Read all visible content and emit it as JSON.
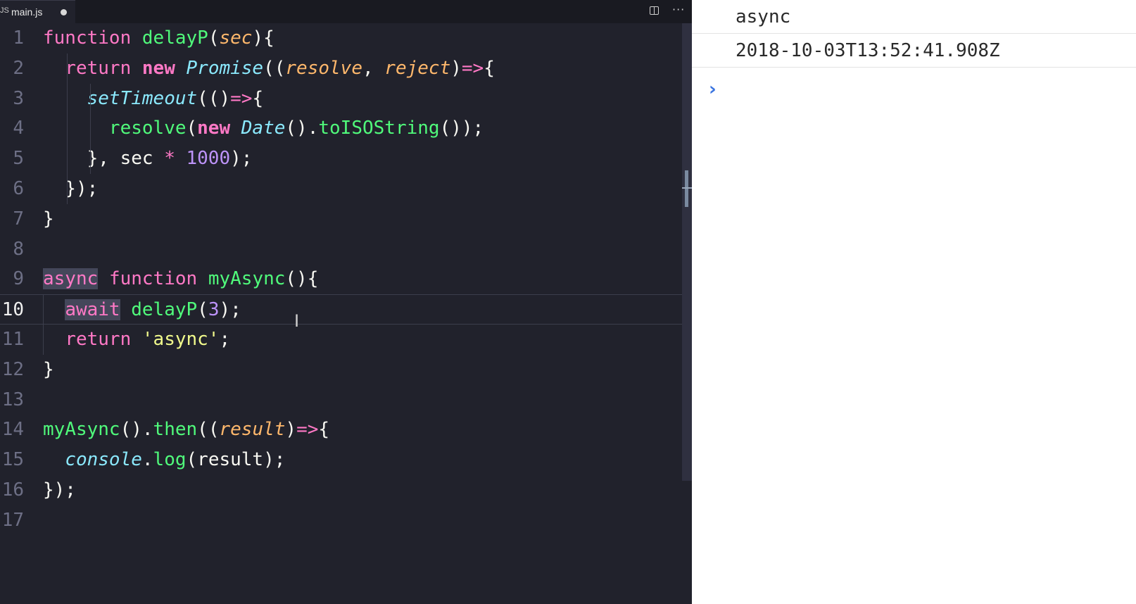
{
  "editor": {
    "tab": {
      "icon": "JS",
      "filename": "main.js"
    },
    "lines": [
      {
        "n": "1",
        "tokens": [
          [
            "kw",
            "function"
          ],
          [
            "punct",
            " "
          ],
          [
            "fn",
            "delayP"
          ],
          [
            "punct",
            "("
          ],
          [
            "param",
            "sec"
          ],
          [
            "punct",
            "){"
          ]
        ]
      },
      {
        "n": "2",
        "tokens": [
          [
            "punct",
            "  "
          ],
          [
            "kw",
            "return"
          ],
          [
            "punct",
            " "
          ],
          [
            "kwb",
            "new"
          ],
          [
            "punct",
            " "
          ],
          [
            "cls",
            "Promise"
          ],
          [
            "punct",
            "(("
          ],
          [
            "param",
            "resolve"
          ],
          [
            "punct",
            ", "
          ],
          [
            "param",
            "reject"
          ],
          [
            "punct",
            ")"
          ],
          [
            "kw",
            "=>"
          ],
          [
            "punct",
            "{"
          ]
        ]
      },
      {
        "n": "3",
        "tokens": [
          [
            "punct",
            "    "
          ],
          [
            "cls",
            "setTimeout"
          ],
          [
            "punct",
            "(()"
          ],
          [
            "kw",
            "=>"
          ],
          [
            "punct",
            "{"
          ]
        ]
      },
      {
        "n": "4",
        "tokens": [
          [
            "punct",
            "      "
          ],
          [
            "fn",
            "resolve"
          ],
          [
            "punct",
            "("
          ],
          [
            "kwb",
            "new"
          ],
          [
            "punct",
            " "
          ],
          [
            "cls",
            "Date"
          ],
          [
            "punct",
            "()."
          ],
          [
            "fn",
            "toISOString"
          ],
          [
            "punct",
            "());"
          ]
        ]
      },
      {
        "n": "5",
        "tokens": [
          [
            "punct",
            "    }, sec "
          ],
          [
            "kw",
            "*"
          ],
          [
            "punct",
            " "
          ],
          [
            "num",
            "1000"
          ],
          [
            "punct",
            ");"
          ]
        ]
      },
      {
        "n": "6",
        "tokens": [
          [
            "punct",
            "  });"
          ]
        ]
      },
      {
        "n": "7",
        "tokens": [
          [
            "punct",
            "}"
          ]
        ]
      },
      {
        "n": "8",
        "tokens": []
      },
      {
        "n": "9",
        "tokens": [
          [
            "kw hl",
            "async"
          ],
          [
            "punct",
            " "
          ],
          [
            "kw",
            "function"
          ],
          [
            "punct",
            " "
          ],
          [
            "fn",
            "myAsync"
          ],
          [
            "punct",
            "(){"
          ]
        ]
      },
      {
        "n": "10",
        "active": true,
        "tokens": [
          [
            "punct",
            "  "
          ],
          [
            "kw hl",
            "await"
          ],
          [
            "punct",
            " "
          ],
          [
            "fn",
            "delayP"
          ],
          [
            "punct",
            "("
          ],
          [
            "num",
            "3"
          ],
          [
            "punct",
            ");"
          ]
        ]
      },
      {
        "n": "11",
        "tokens": [
          [
            "punct",
            "  "
          ],
          [
            "kw",
            "return"
          ],
          [
            "punct",
            " "
          ],
          [
            "str",
            "'async'"
          ],
          [
            "punct",
            ";"
          ]
        ]
      },
      {
        "n": "12",
        "tokens": [
          [
            "punct",
            "}"
          ]
        ]
      },
      {
        "n": "13",
        "tokens": []
      },
      {
        "n": "14",
        "tokens": [
          [
            "fn",
            "myAsync"
          ],
          [
            "punct",
            "()."
          ],
          [
            "fn",
            "then"
          ],
          [
            "punct",
            "(("
          ],
          [
            "param",
            "result"
          ],
          [
            "punct",
            ")"
          ],
          [
            "kw",
            "=>"
          ],
          [
            "punct",
            "{"
          ]
        ]
      },
      {
        "n": "15",
        "tokens": [
          [
            "punct",
            "  "
          ],
          [
            "cls",
            "console"
          ],
          [
            "punct",
            "."
          ],
          [
            "fn",
            "log"
          ],
          [
            "punct",
            "(result);"
          ]
        ]
      },
      {
        "n": "16",
        "tokens": [
          [
            "punct",
            "});"
          ]
        ]
      },
      {
        "n": "17",
        "tokens": []
      }
    ]
  },
  "console": {
    "lines": [
      "async",
      "2018-10-03T13:52:41.908Z"
    ],
    "prompt_icon": "chevron-right-icon",
    "prompt_color": "#3a74e0"
  },
  "colors": {
    "editor_bg": "#21222c",
    "keyword": "#ff79c6",
    "function": "#50fa7b",
    "param": "#ffb86c",
    "class": "#8be9fd",
    "number": "#bd93f9",
    "string": "#f1fa8c"
  }
}
